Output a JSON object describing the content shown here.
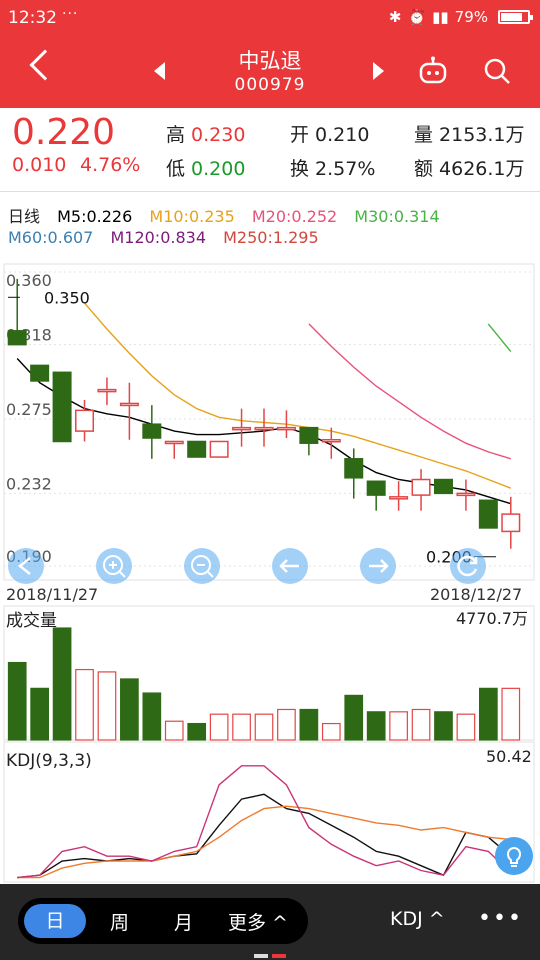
{
  "status_bar": {
    "time": "12:32",
    "dots": "···",
    "battery": "79%",
    "battery_level": 0.79
  },
  "header": {
    "title": "中弘退",
    "code": "000979"
  },
  "quote": {
    "price": "0.220",
    "change": "0.010",
    "change_pct": "4.76%",
    "high_label": "高",
    "high": "0.230",
    "low_label": "低",
    "low": "0.200",
    "open_label": "开",
    "open": "0.210",
    "turnover_label": "换",
    "turnover": "2.57%",
    "volume_label": "量",
    "volume": "2153.1万",
    "amount_label": "额",
    "amount": "4626.1万"
  },
  "ma": {
    "period": "日线",
    "m5": "M5:0.226",
    "m10": "M10:0.235",
    "m20": "M20:0.252",
    "m30": "M30:0.314",
    "m60": "M60:0.607",
    "m120": "M120:0.834",
    "m250": "M250:1.295",
    "colors": {
      "m5": "#000000",
      "m10": "#e6a21a",
      "m20": "#e8527a",
      "m30": "#49b344",
      "m60": "#3c7fb0",
      "m120": "#7b1c7b",
      "m250": "#d2473d"
    }
  },
  "chart_data": [
    {
      "type": "candlestick",
      "y_ticks": [
        "0.360",
        "0.318",
        "0.275",
        "0.232",
        "0.190"
      ],
      "ylim": [
        0.19,
        0.36
      ],
      "max_label": "0.350",
      "min_label": "0.200",
      "date_start": "2018/11/27",
      "date_end": "2018/12/27",
      "candles": [
        {
          "o": 0.326,
          "c": 0.318,
          "h": 0.356,
          "l": 0.318
        },
        {
          "o": 0.306,
          "c": 0.297,
          "h": 0.306,
          "l": 0.297
        },
        {
          "o": 0.302,
          "c": 0.262,
          "h": 0.302,
          "l": 0.262
        },
        {
          "o": 0.268,
          "c": 0.28,
          "h": 0.286,
          "l": 0.262
        },
        {
          "o": 0.292,
          "c": 0.292,
          "h": 0.299,
          "l": 0.283
        },
        {
          "o": 0.284,
          "c": 0.284,
          "h": 0.296,
          "l": 0.263
        },
        {
          "o": 0.272,
          "c": 0.264,
          "h": 0.283,
          "l": 0.252
        },
        {
          "o": 0.262,
          "c": 0.262,
          "h": 0.262,
          "l": 0.252
        },
        {
          "o": 0.262,
          "c": 0.253,
          "h": 0.262,
          "l": 0.253
        },
        {
          "o": 0.253,
          "c": 0.262,
          "h": 0.262,
          "l": 0.253
        },
        {
          "o": 0.27,
          "c": 0.27,
          "h": 0.281,
          "l": 0.259
        },
        {
          "o": 0.27,
          "c": 0.27,
          "h": 0.281,
          "l": 0.259
        },
        {
          "o": 0.27,
          "c": 0.27,
          "h": 0.28,
          "l": 0.264
        },
        {
          "o": 0.27,
          "c": 0.261,
          "h": 0.27,
          "l": 0.254
        },
        {
          "o": 0.263,
          "c": 0.263,
          "h": 0.27,
          "l": 0.252
        },
        {
          "o": 0.252,
          "c": 0.241,
          "h": 0.258,
          "l": 0.229
        },
        {
          "o": 0.239,
          "c": 0.231,
          "h": 0.239,
          "l": 0.222
        },
        {
          "o": 0.23,
          "c": 0.23,
          "h": 0.239,
          "l": 0.222
        },
        {
          "o": 0.231,
          "c": 0.24,
          "h": 0.246,
          "l": 0.222
        },
        {
          "o": 0.24,
          "c": 0.232,
          "h": 0.24,
          "l": 0.232
        },
        {
          "o": 0.232,
          "c": 0.232,
          "h": 0.24,
          "l": 0.222
        },
        {
          "o": 0.228,
          "c": 0.212,
          "h": 0.228,
          "l": 0.212
        },
        {
          "o": 0.21,
          "c": 0.22,
          "h": 0.23,
          "l": 0.2
        }
      ],
      "series": [
        {
          "name": "M5",
          "values": [
            0.31,
            0.296,
            0.288,
            0.281,
            0.278,
            0.276,
            0.272,
            0.268,
            0.266,
            0.266,
            0.267,
            0.268,
            0.27,
            0.266,
            0.26,
            0.251,
            0.244,
            0.24,
            0.238,
            0.236,
            0.234,
            0.23,
            0.226
          ]
        },
        {
          "name": "M10",
          "values": [
            null,
            null,
            null,
            0.342,
            0.327,
            0.313,
            0.3,
            0.289,
            0.281,
            0.276,
            0.274,
            0.273,
            0.272,
            0.27,
            0.268,
            0.265,
            0.261,
            0.257,
            0.253,
            0.249,
            0.245,
            0.24,
            0.235
          ]
        },
        {
          "name": "M20",
          "values": [
            null,
            null,
            null,
            null,
            null,
            null,
            null,
            null,
            null,
            null,
            null,
            null,
            null,
            0.33,
            0.317,
            0.305,
            0.294,
            0.285,
            0.276,
            0.268,
            0.261,
            0.256,
            0.252
          ]
        },
        {
          "name": "M30",
          "values": [
            null,
            null,
            null,
            null,
            null,
            null,
            null,
            null,
            null,
            null,
            null,
            null,
            null,
            null,
            null,
            null,
            null,
            null,
            null,
            null,
            null,
            0.33,
            0.314
          ]
        }
      ]
    },
    {
      "type": "bar",
      "title": "成交量",
      "max_label": "4770.7万",
      "values": [
        3300,
        2200,
        4770,
        3000,
        2900,
        2600,
        2000,
        800,
        700,
        1100,
        1100,
        1100,
        1300,
        1300,
        700,
        1900,
        1200,
        1200,
        1300,
        1200,
        1100,
        2200,
        2200
      ],
      "up": [
        false,
        false,
        false,
        true,
        true,
        false,
        false,
        true,
        false,
        true,
        true,
        true,
        true,
        false,
        true,
        false,
        false,
        true,
        true,
        false,
        true,
        false,
        true
      ],
      "ylim": [
        0,
        4770.7
      ]
    },
    {
      "type": "line",
      "title": "KDJ(9,3,3)",
      "max_label": "50.42",
      "ylim": [
        0,
        50.42
      ],
      "series": [
        {
          "name": "K",
          "values": [
            1,
            2,
            8,
            9,
            8,
            9,
            8,
            10,
            11,
            23,
            34,
            36,
            30,
            28,
            23,
            18,
            12,
            10,
            6,
            2,
            20,
            18,
            10
          ]
        },
        {
          "name": "D",
          "values": [
            1,
            1,
            5,
            7,
            8,
            8,
            8,
            10,
            12,
            18,
            25,
            30,
            31,
            30,
            28,
            26,
            24,
            23,
            21,
            22,
            20,
            18,
            17
          ]
        },
        {
          "name": "J",
          "values": [
            1,
            2,
            12,
            14,
            10,
            10,
            8,
            12,
            14,
            40,
            48,
            48,
            40,
            22,
            15,
            10,
            6,
            8,
            4,
            2,
            14,
            12,
            3
          ]
        }
      ]
    }
  ],
  "tabs": {
    "day": "日",
    "week": "周",
    "month": "月",
    "more": "更多 ^",
    "indicator": "KDJ ^",
    "dots": "•••"
  }
}
